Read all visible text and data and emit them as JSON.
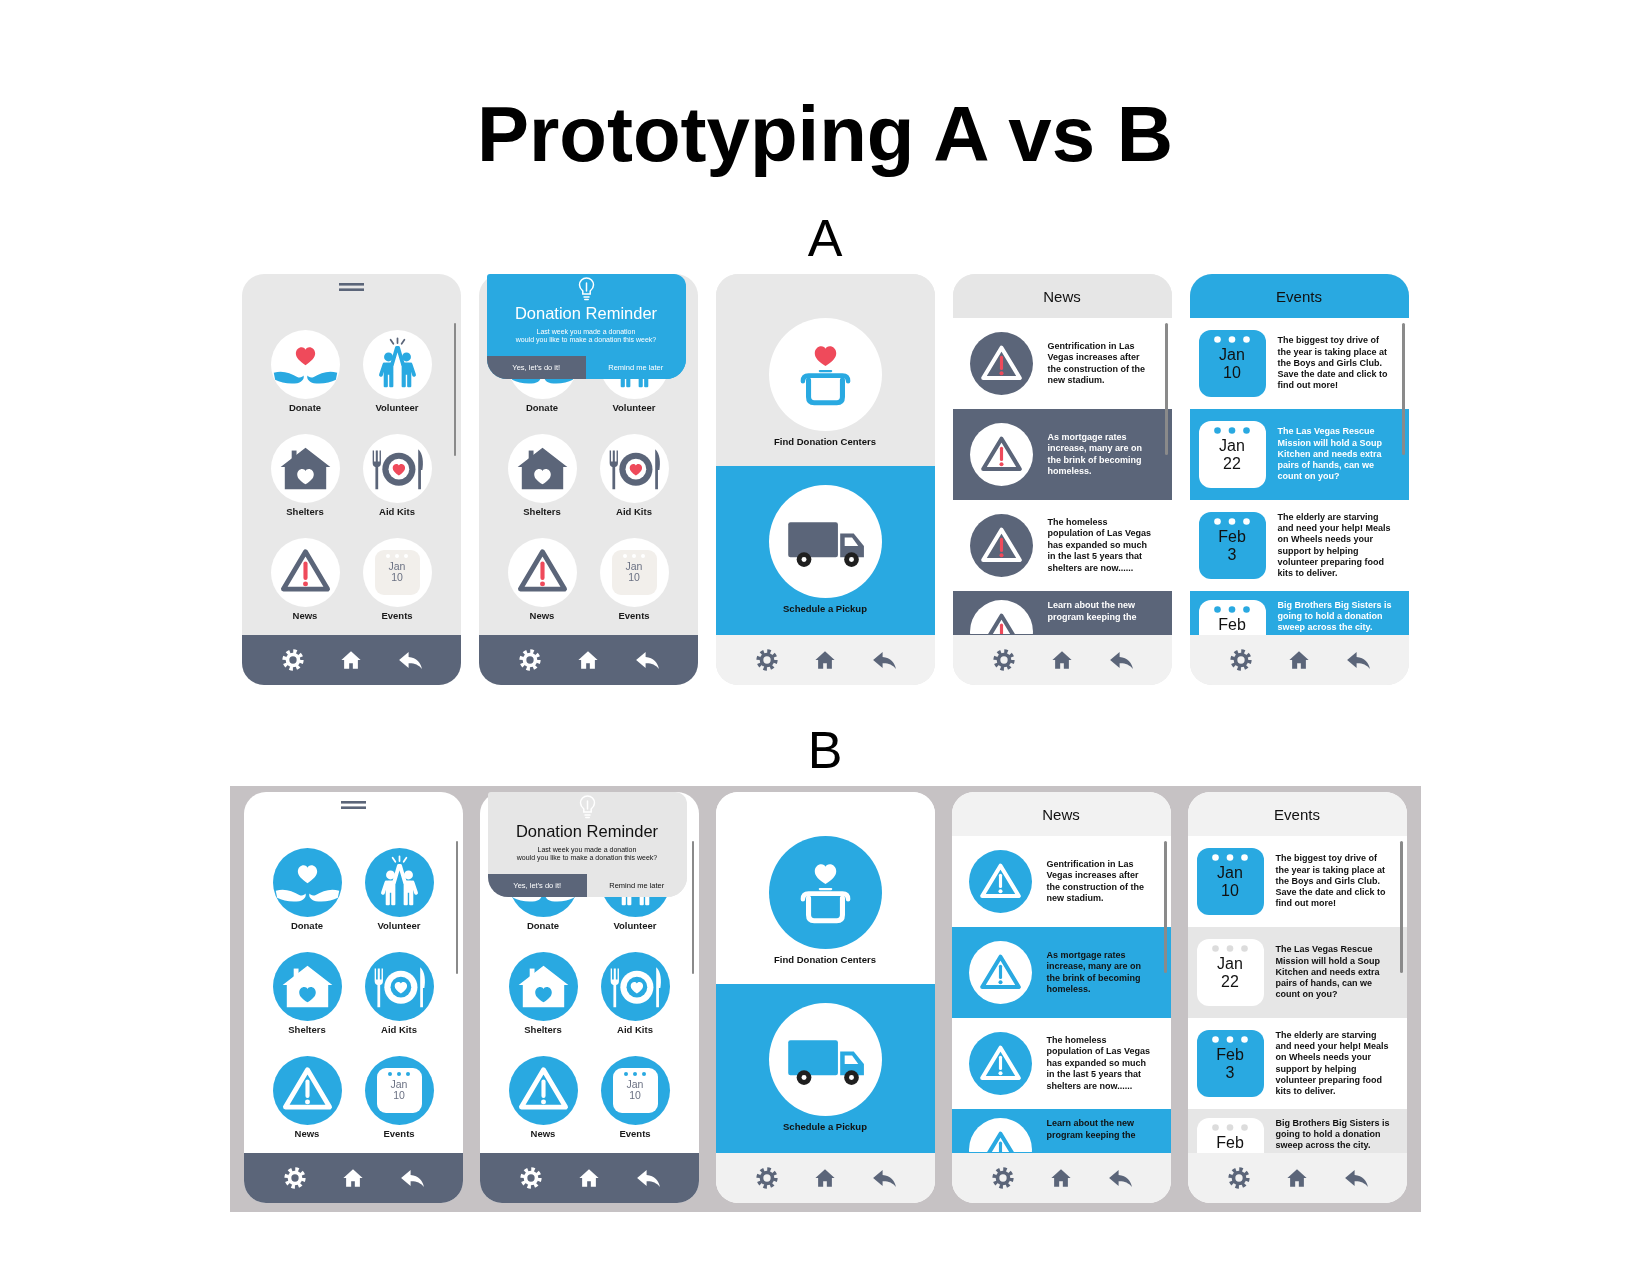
{
  "title": "Prototyping A vs B",
  "variants": [
    {
      "label": "A",
      "kind": "neutral",
      "screens": [
        {
          "kind": "menu",
          "rows": [
            {
              "items": [
                {
                  "kind": "icon",
                  "label": "Donate"
                },
                {
                  "kind": "icon",
                  "label": "Volunteer"
                }
              ]
            },
            {
              "items": [
                {
                  "kind": "icon",
                  "label": "Shelters"
                },
                {
                  "kind": "icon",
                  "label": "Aid Kits"
                }
              ]
            },
            {
              "items": [
                {
                  "kind": "icon",
                  "label": "News"
                },
                {
                  "kind": "calendar",
                  "label": "Events",
                  "month": "Jan",
                  "day": "10"
                }
              ]
            }
          ]
        },
        {
          "kind": "menu",
          "popup": {
            "title": "Donation Reminder",
            "message": "Last week you made a donation\nwould you like to make a donation this week?",
            "buttons": [
              "Yes, let's do it!",
              "Remind me later"
            ]
          },
          "rows": [
            {
              "items": [
                {
                  "kind": "icon",
                  "label": "Donate"
                },
                {
                  "kind": "icon",
                  "label": "Volunteer"
                }
              ]
            },
            {
              "items": [
                {
                  "kind": "icon",
                  "label": "Shelters"
                },
                {
                  "kind": "icon",
                  "label": "Aid Kits"
                }
              ]
            },
            {
              "items": [
                {
                  "kind": "icon",
                  "label": "News"
                },
                {
                  "kind": "calendar",
                  "label": "Events",
                  "month": "Jan",
                  "day": "10"
                }
              ]
            }
          ]
        },
        {
          "kind": "split",
          "sections": [
            {
              "label": "Find Donation Centers"
            },
            {
              "label": "Schedule a Pickup"
            }
          ]
        },
        {
          "kind": "news",
          "header": "News",
          "items": [
            {
              "text": "Gentrification in Las Vegas increases after the construction of the new stadium."
            },
            {
              "text": "As mortgage rates increase, many are on the brink of becoming homeless."
            },
            {
              "text": "The homeless population of Las Vegas has expanded so much in the last 5 years that shelters are now......"
            },
            {
              "text": "Learn about the new program keeping the"
            }
          ]
        },
        {
          "kind": "events",
          "header": "Events",
          "items": [
            {
              "month": "Jan",
              "day": "10",
              "text": "The biggest toy drive of the year is taking place at the Boys and Girls Club. Save the date and click to find out more!"
            },
            {
              "month": "Jan",
              "day": "22",
              "text": "The Las Vegas Rescue Mission will hold a Soup Kitchen and needs extra pairs of hands, can we count on you?"
            },
            {
              "month": "Feb",
              "day": "3",
              "text": "The elderly are starving and need your help! Meals on Wheels needs your support by helping volunteer preparing food kits to deliver."
            },
            {
              "month": "Feb",
              "text": "Big Brothers Big Sisters is going to hold a donation sweep across the city."
            }
          ]
        }
      ]
    },
    {
      "label": "B",
      "kind": "accent",
      "screens": [
        {
          "kind": "menu",
          "rows": [
            {
              "items": [
                {
                  "kind": "icon",
                  "label": "Donate"
                },
                {
                  "kind": "icon",
                  "label": "Volunteer"
                }
              ]
            },
            {
              "items": [
                {
                  "kind": "icon",
                  "label": "Shelters"
                },
                {
                  "kind": "icon",
                  "label": "Aid Kits"
                }
              ]
            },
            {
              "items": [
                {
                  "kind": "icon",
                  "label": "News"
                },
                {
                  "kind": "calendar",
                  "label": "Events",
                  "month": "Jan",
                  "day": "10"
                }
              ]
            }
          ]
        },
        {
          "kind": "menu",
          "popup": {
            "title": "Donation Reminder",
            "message": "Last week you made a donation\nwould you like to make a donation this week?",
            "buttons": [
              "Yes, let's do it!",
              "Remind me later"
            ]
          },
          "rows": [
            {
              "items": [
                {
                  "kind": "icon",
                  "label": "Donate"
                },
                {
                  "kind": "icon",
                  "label": "Volunteer"
                }
              ]
            },
            {
              "items": [
                {
                  "kind": "icon",
                  "label": "Shelters"
                },
                {
                  "kind": "icon",
                  "label": "Aid Kits"
                }
              ]
            },
            {
              "items": [
                {
                  "kind": "icon",
                  "label": "News"
                },
                {
                  "kind": "calendar",
                  "label": "Events",
                  "month": "Jan",
                  "day": "10"
                }
              ]
            }
          ]
        },
        {
          "kind": "split",
          "sections": [
            {
              "label": "Find Donation Centers"
            },
            {
              "label": "Schedule a Pickup"
            }
          ]
        },
        {
          "kind": "news",
          "header": "News",
          "items": [
            {
              "text": "Gentrification in Las Vegas increases after the construction of the new stadium."
            },
            {
              "text": "As mortgage rates increase, many are on the brink of becoming homeless."
            },
            {
              "text": "The homeless population of Las Vegas has expanded so much in the last 5 years that shelters are now......"
            },
            {
              "text": "Learn about the new program keeping the"
            }
          ]
        },
        {
          "kind": "events",
          "header": "Events",
          "items": [
            {
              "month": "Jan",
              "day": "10",
              "text": "The biggest toy drive of the year is taking place at the Boys and Girls Club. Save the date and click to find out more!"
            },
            {
              "month": "Jan",
              "day": "22",
              "text": "The Las Vegas Rescue Mission will hold a Soup Kitchen and needs extra pairs of hands, can we count on you?"
            },
            {
              "month": "Feb",
              "day": "3",
              "text": "The elderly are starving and need your help! Meals on Wheels needs your support by helping volunteer preparing food kits to deliver."
            },
            {
              "month": "Feb",
              "text": "Big Brothers Big Sisters is going to hold a donation sweep across the city."
            }
          ]
        }
      ]
    }
  ]
}
